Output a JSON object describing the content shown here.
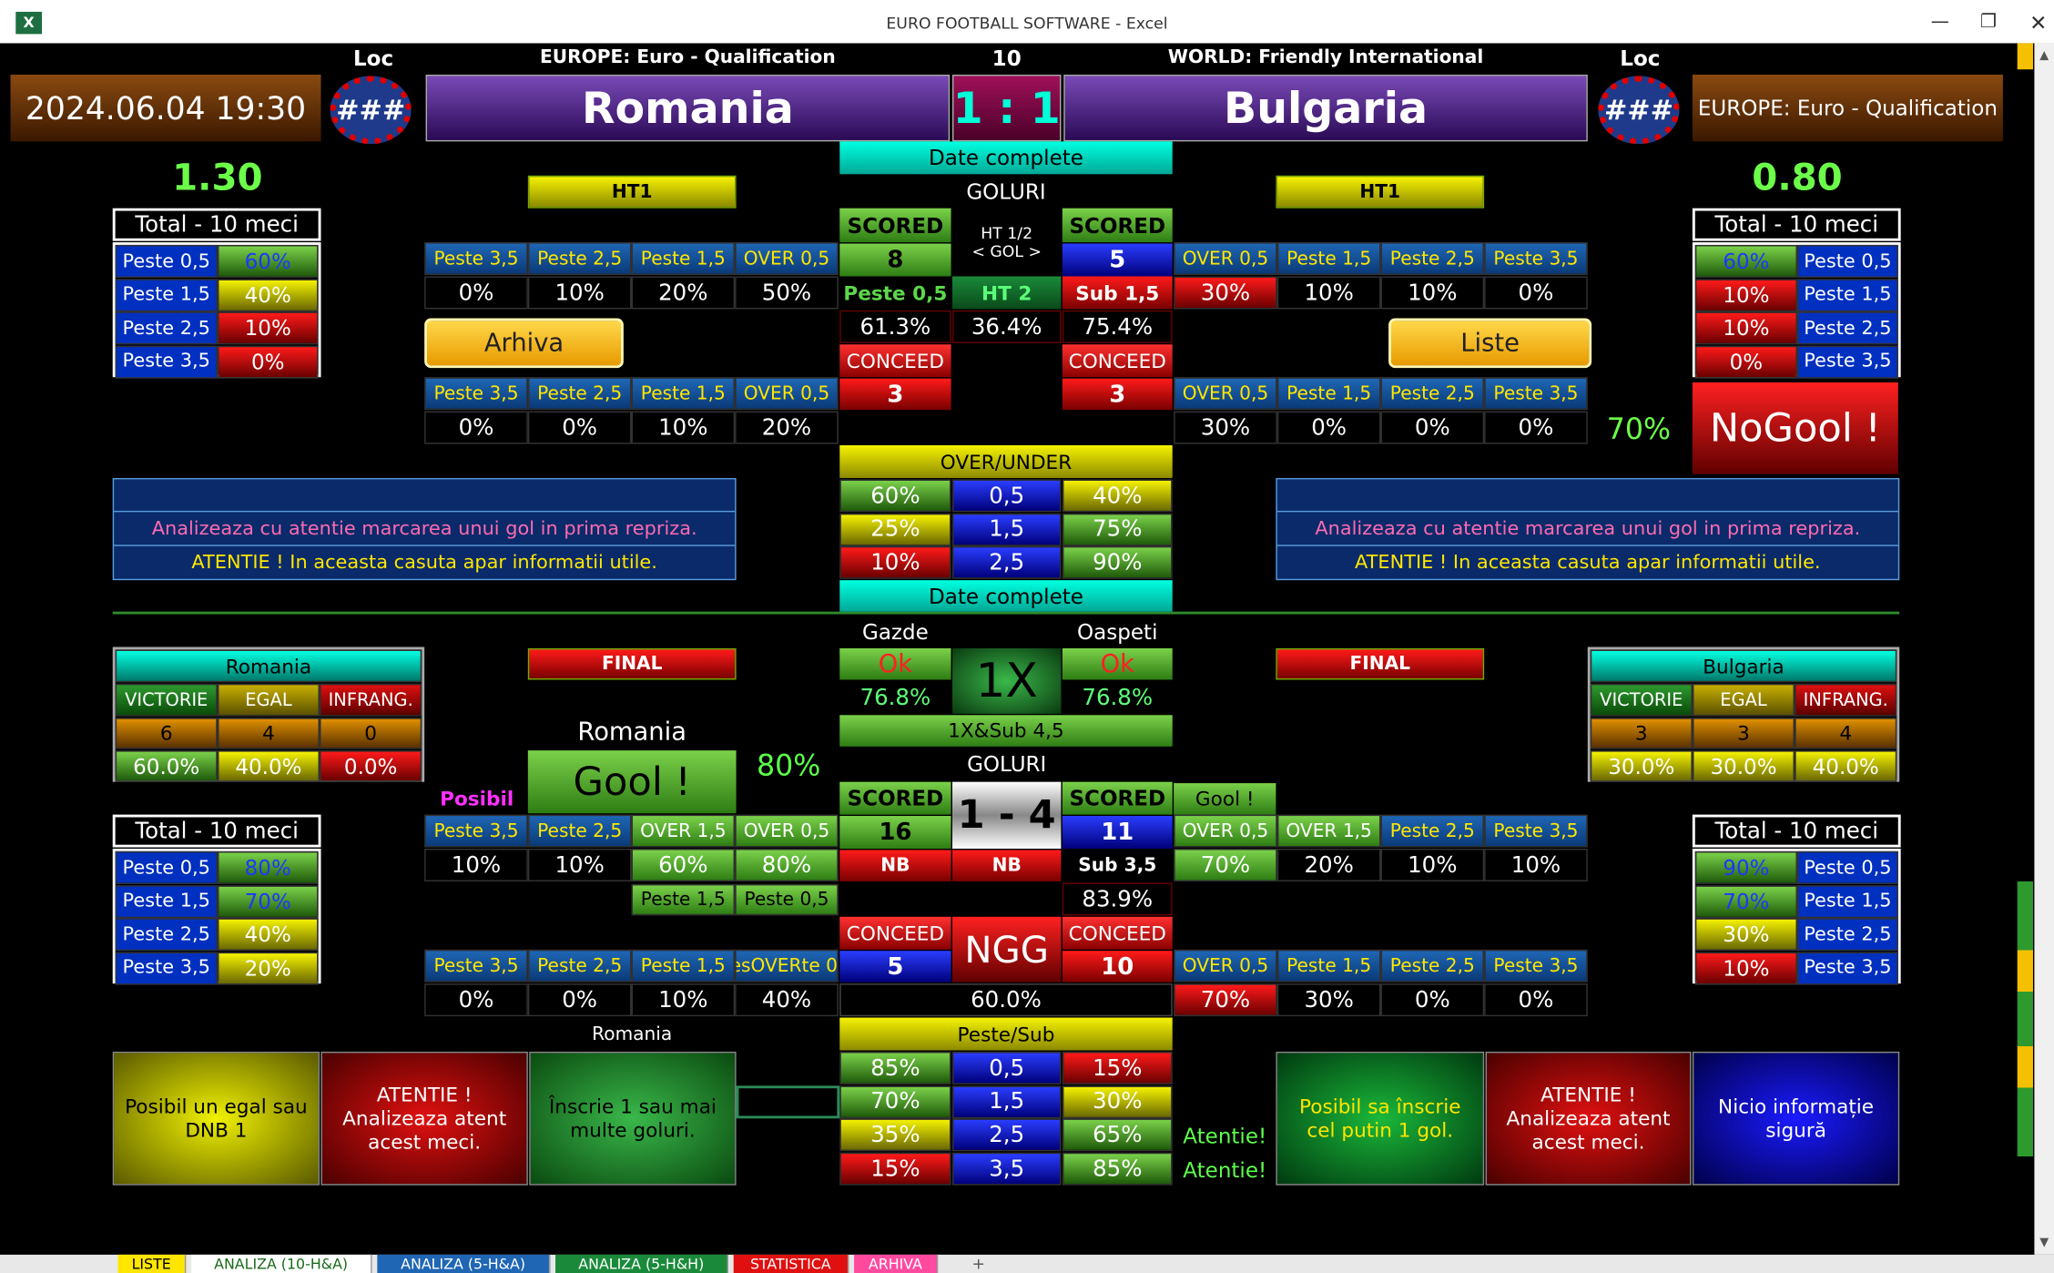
{
  "window": {
    "title": "EURO FOOTBALL SOFTWARE - Excel"
  },
  "header": {
    "datetime": "2024.06.04 19:30",
    "loc_label": "Loc",
    "loc_left": "###",
    "loc_right": "###",
    "league_left": "EUROPE: Euro - Qualification",
    "round": "10",
    "league_right": "WORLD: Friendly International",
    "home": "Romania",
    "away": "Bulgaria",
    "score": "1 : 1",
    "right_box": "EUROPE: Euro - Qualification"
  },
  "top": {
    "date_complete": "Date complete",
    "goluri": "GOLURI",
    "ht1": "HT1",
    "left_odds": "1.30",
    "right_odds": "0.80",
    "total_title": "Total - 10 meci",
    "left_total": [
      [
        "Peste 0,5",
        "60%"
      ],
      [
        "Peste 1,5",
        "40%"
      ],
      [
        "Peste 2,5",
        "10%"
      ],
      [
        "Peste 3,5",
        "0%"
      ]
    ],
    "right_total": [
      [
        "60%",
        "Peste 0,5"
      ],
      [
        "10%",
        "Peste 1,5"
      ],
      [
        "10%",
        "Peste 2,5"
      ],
      [
        "0%",
        "Peste 3,5"
      ]
    ],
    "scored": "SCORED",
    "conceded": "CONCEED",
    "home_scored": "8",
    "away_scored": "5",
    "home_conceded": "3",
    "away_conceded": "3",
    "ht_half": "HT 1/2",
    "gol_arrows": "< GOL >",
    "peste05": "Peste 0,5",
    "ht2": "HT 2",
    "sub15": "Sub 1,5",
    "pct_a": "61.3%",
    "pct_b": "36.4%",
    "pct_c": "75.4%",
    "left_scored_hdr": [
      "Peste 3,5",
      "Peste 2,5",
      "Peste 1,5",
      "OVER 0,5"
    ],
    "left_scored_val": [
      "0%",
      "10%",
      "20%",
      "50%"
    ],
    "right_scored_hdr": [
      "OVER 0,5",
      "Peste 1,5",
      "Peste 2,5",
      "Peste 3,5"
    ],
    "right_scored_val": [
      "30%",
      "10%",
      "10%",
      "0%"
    ],
    "left_conc_hdr": [
      "Peste 3,5",
      "Peste 2,5",
      "Peste 1,5",
      "OVER 0,5"
    ],
    "left_conc_val": [
      "0%",
      "0%",
      "10%",
      "20%"
    ],
    "right_conc_hdr": [
      "OVER 0,5",
      "Peste 1,5",
      "Peste 2,5",
      "Peste 3,5"
    ],
    "right_conc_val": [
      "30%",
      "0%",
      "0%",
      "0%"
    ],
    "arhiva_btn": "Arhiva",
    "liste_btn": "Liste",
    "right_pct": "70%",
    "nogool": "NoGool !",
    "over_under": "OVER/UNDER",
    "ou_rows": [
      [
        "60%",
        "0,5",
        "40%"
      ],
      [
        "25%",
        "1,5",
        "75%"
      ],
      [
        "10%",
        "2,5",
        "90%"
      ]
    ],
    "info_line1": "Analizeaza cu atentie marcarea unui gol in prima repriza.",
    "info_line2": "ATENTIE ! In aceasta casuta apar informatii utile."
  },
  "bottom": {
    "date_complete": "Date complete",
    "gazde": "Gazde",
    "oaspeti": "Oaspeti",
    "ok": "Ok",
    "one_x": "1X",
    "home_pct": "76.8%",
    "away_pct": "76.8%",
    "combo": "1X&Sub 4,5",
    "goluri": "GOLURI",
    "final": "FINAL",
    "home_team": "Romania",
    "away_team": "Bulgaria",
    "res_hdr": [
      "VICTORIE",
      "EGAL",
      "INFRANG."
    ],
    "home_res": [
      "6",
      "4",
      "0"
    ],
    "home_res_pct": [
      "60.0%",
      "40.0%",
      "0.0%"
    ],
    "away_res": [
      "3",
      "3",
      "4"
    ],
    "away_res_pct": [
      "30.0%",
      "30.0%",
      "40.0%"
    ],
    "gool_label": "Romania",
    "gool": "Gool !",
    "gool_pct": "80%",
    "posibil": "Posibil",
    "gool_small": "Gool !",
    "scored": "SCORED",
    "conceded": "CONCEED",
    "score_pred": "1 - 4",
    "home_scored": "16",
    "away_scored": "11",
    "nb1": "NB",
    "nb2": "NB",
    "sub35": "Sub 3,5",
    "pct_sub": "83.9%",
    "ngg": "NGG",
    "home_conceded": "5",
    "away_conceded": "10",
    "ngg_pct": "60.0%",
    "total_title": "Total - 10 meci",
    "left_total": [
      [
        "Peste 0,5",
        "80%"
      ],
      [
        "Peste 1,5",
        "70%"
      ],
      [
        "Peste 2,5",
        "40%"
      ],
      [
        "Peste 3,5",
        "20%"
      ]
    ],
    "right_total": [
      [
        "90%",
        "Peste 0,5"
      ],
      [
        "70%",
        "Peste 1,5"
      ],
      [
        "30%",
        "Peste 2,5"
      ],
      [
        "10%",
        "Peste 3,5"
      ]
    ],
    "left_s_hdr": [
      "Peste 3,5",
      "Peste 2,5",
      "OVER 1,5",
      "OVER 0,5"
    ],
    "left_s_val": [
      "10%",
      "10%",
      "60%",
      "80%"
    ],
    "left_sub_hdr": [
      "Peste 1,5",
      "Peste 0,5"
    ],
    "right_s_hdr": [
      "OVER 0,5",
      "OVER 1,5",
      "Peste 2,5",
      "Peste 3,5"
    ],
    "right_s_val": [
      "70%",
      "20%",
      "10%",
      "10%"
    ],
    "left_c_hdr": [
      "Peste 3,5",
      "Peste 2,5",
      "Peste 1,5",
      "esOVERte 0,"
    ],
    "left_c_val": [
      "0%",
      "0%",
      "10%",
      "40%"
    ],
    "right_c_hdr": [
      "OVER 0,5",
      "Peste 1,5",
      "Peste 2,5",
      "Peste 3,5"
    ],
    "right_c_val": [
      "70%",
      "30%",
      "0%",
      "0%"
    ],
    "romania_small": "Romania",
    "peste_sub": "Peste/Sub",
    "ps_rows": [
      [
        "85%",
        "0,5",
        "15%"
      ],
      [
        "70%",
        "1,5",
        "30%"
      ],
      [
        "35%",
        "2,5",
        "65%"
      ],
      [
        "15%",
        "3,5",
        "85%"
      ]
    ],
    "atentie": "Atentie!",
    "box1": "Posibil un egal sau DNB 1",
    "box2": "ATENTIE ! Analizeaza atent acest meci.",
    "box3": "Înscrie 1 sau mai multe goluri.",
    "box4": "Posibil sa înscrie cel putin 1 gol.",
    "box5": "ATENTIE ! Analizeaza atent acest meci.",
    "box6": "Nicio informație sigură"
  },
  "tabs": [
    "LISTE",
    "ANALIZA (10-H&A)",
    "ANALIZA (5-H&A)",
    "ANALIZA (5-H&H)",
    "STATISTICA",
    "ARHIVA"
  ]
}
